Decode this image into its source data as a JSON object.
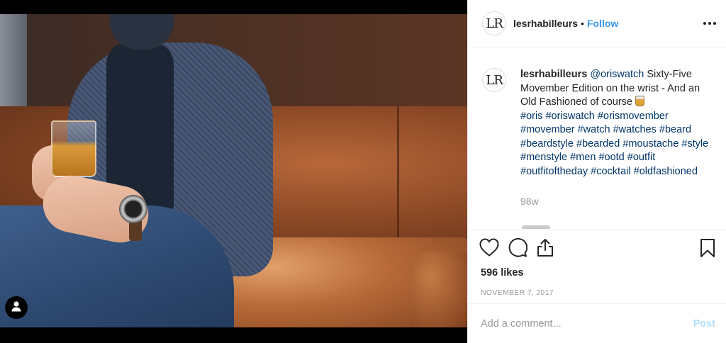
{
  "post": {
    "image_alt": "Man in tweed jacket holding whisky glass on leather couch"
  },
  "header": {
    "avatar_text": "LR",
    "username": "lesrhabilleurs",
    "separator": "•",
    "follow_label": "Follow"
  },
  "caption": {
    "avatar_text": "LR",
    "username": "lesrhabilleurs",
    "mention": "@oriswatch",
    "text": "Sixty-Five Movember Edition on the wrist - And an Old Fashioned of course",
    "hashtags": [
      "#oris",
      "#oriswatch",
      "#orismovember",
      "#movember",
      "#watch",
      "#watches",
      "#beard",
      "#beardstyle",
      "#bearded",
      "#moustache",
      "#style",
      "#menstyle",
      "#men",
      "#ootd",
      "#outfit",
      "#outfitoftheday",
      "#cocktail",
      "#oldfashioned"
    ],
    "time": "98w"
  },
  "actions": {
    "likes": "596 likes",
    "date": "November 7, 2017"
  },
  "comment_box": {
    "placeholder": "Add a comment...",
    "post_label": "Post"
  },
  "colors": {
    "follow_blue": "#3897f0",
    "link_navy": "#003569",
    "post_disabled": "#b2dffc",
    "muted_gray": "#999999"
  },
  "icons": [
    "user-tag-icon",
    "more-options-icon",
    "heart-icon",
    "comment-icon",
    "share-icon",
    "bookmark-icon",
    "glass-emoji-icon"
  ]
}
